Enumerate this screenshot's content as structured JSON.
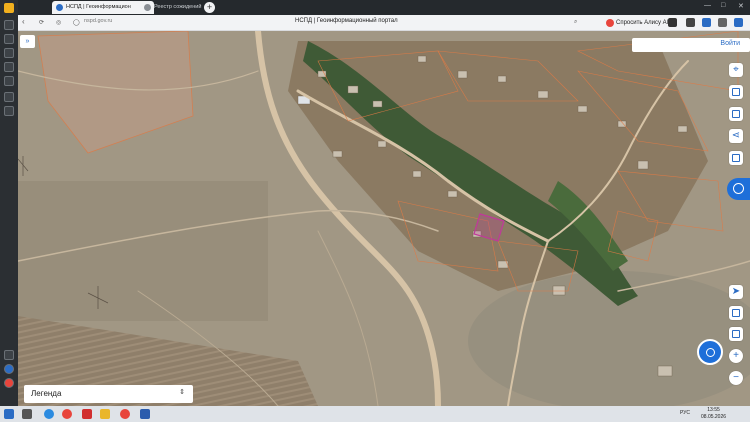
{
  "browser": {
    "tabs": [
      {
        "title": "НСПД | Геоинформацион",
        "active": true
      },
      {
        "title": "Реестр сожидений",
        "active": false
      }
    ],
    "url": "nspd.gov.ru",
    "page_title": "НСПД | Геоинформационный портал",
    "alice_label": "Спросить Алису AI"
  },
  "map": {
    "login_label": "Войти",
    "legend_label": "Легенда",
    "zoom_in": "+",
    "zoom_out": "−",
    "colors": {
      "cadastral_border": "#e07a45",
      "highlight_parcel": "#c0399a",
      "accent": "#1e6fd9"
    }
  },
  "taskbar": {
    "lang": "РУС",
    "time": "13:55",
    "date": "08.05.2026"
  }
}
